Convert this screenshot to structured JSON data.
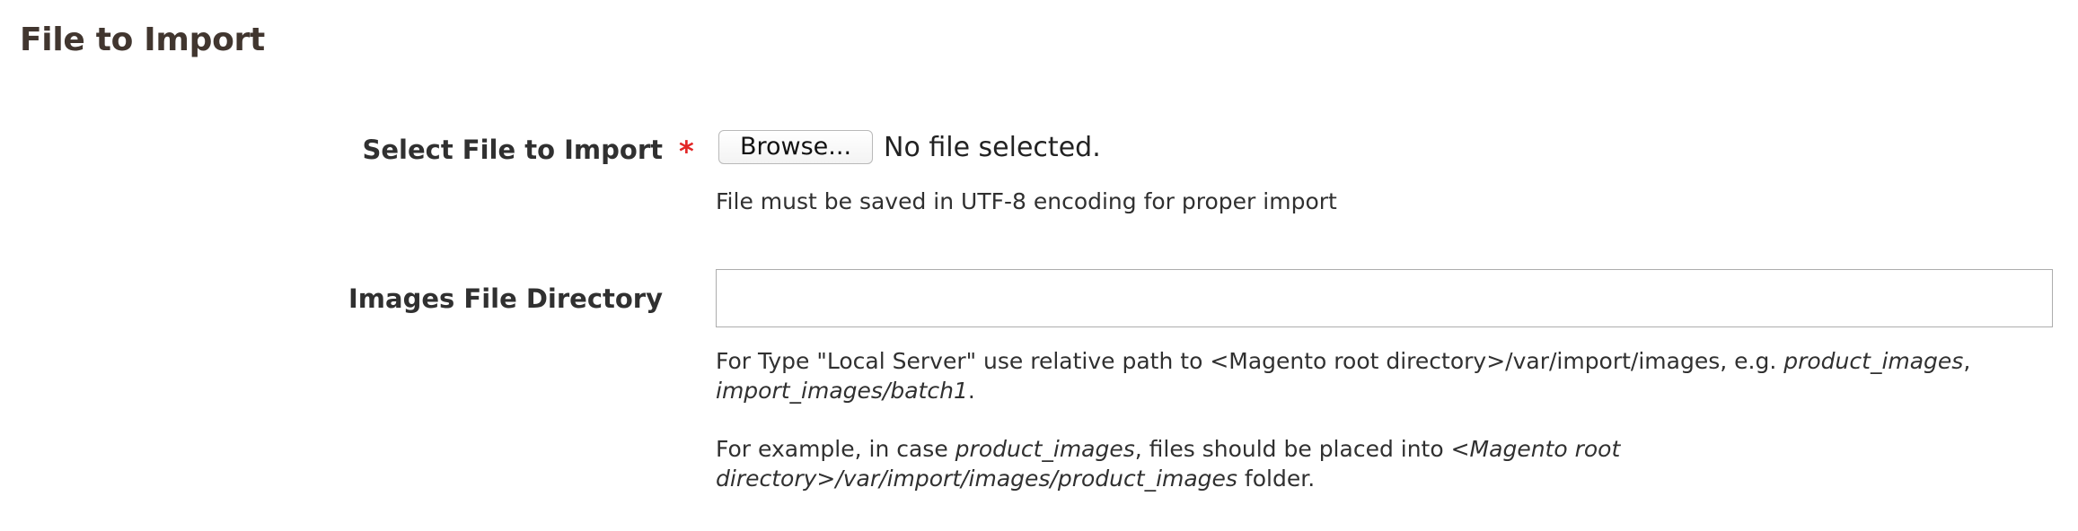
{
  "section": {
    "title": "File to Import"
  },
  "file_field": {
    "label": "Select File to Import",
    "required_mark": "*",
    "browse_label": "Browse...",
    "status_text": "No file selected.",
    "note": "File must be saved in UTF-8 encoding for proper import"
  },
  "images_field": {
    "label": "Images File Directory",
    "value": "",
    "placeholder": "",
    "note_local": {
      "prefix": "For Type \"Local Server\" use relative path to <Magento root directory>/var/import/images, e.g. ",
      "example1": "product_images",
      "separator": ", ",
      "example2": "import_images/batch1",
      "suffix": "."
    },
    "note_example": {
      "prefix": "For example, in case ",
      "example": "product_images",
      "middle": ", files should be placed into ",
      "path": "<Magento root directory>/var/import/images/product_images",
      "suffix": " folder."
    }
  },
  "colors": {
    "title": "#41362f",
    "label": "#303030",
    "required": "#e22626",
    "input_border": "#adadad"
  }
}
